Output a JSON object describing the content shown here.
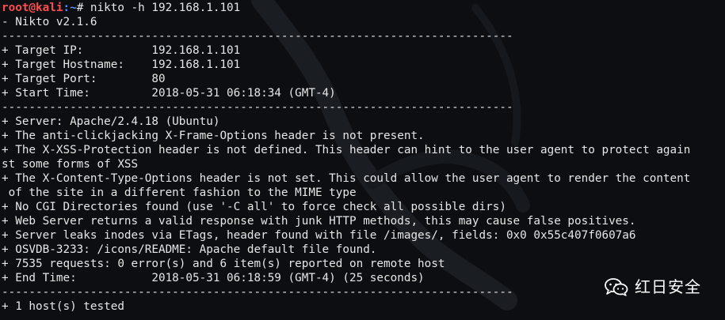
{
  "terminal": {
    "prompt": {
      "user_host": "root@kali",
      "path": ":~",
      "symbol": "#",
      "command": " nikto -h 192.168.1.101"
    },
    "lines": [
      "- Nikto v2.1.6",
      "---------------------------------------------------------------------------",
      "+ Target IP:          192.168.1.101",
      "+ Target Hostname:    192.168.1.101",
      "+ Target Port:        80",
      "+ Start Time:         2018-05-31 06:18:34 (GMT-4)",
      "---------------------------------------------------------------------------",
      "+ Server: Apache/2.4.18 (Ubuntu)",
      "+ The anti-clickjacking X-Frame-Options header is not present.",
      "+ The X-XSS-Protection header is not defined. This header can hint to the user agent to protect again",
      "st some forms of XSS",
      "+ The X-Content-Type-Options header is not set. This could allow the user agent to render the content",
      " of the site in a different fashion to the MIME type",
      "+ No CGI Directories found (use '-C all' to force check all possible dirs)",
      "+ Web Server returns a valid response with junk HTTP methods, this may cause false positives.",
      "+ Server leaks inodes via ETags, header found with file /images/, fields: 0x0 0x55c407f0607a6",
      "+ OSVDB-3233: /icons/README: Apache default file found.",
      "+ 7535 requests: 0 error(s) and 6 item(s) reported on remote host",
      "+ End Time:           2018-05-31 06:18:59 (GMT-4) (25 seconds)",
      "---------------------------------------------------------------------------",
      "+ 1 host(s) tested"
    ]
  },
  "watermark": {
    "icon": "wechat-icon",
    "text": "红日安全"
  },
  "colors": {
    "background": "#0c0e11",
    "text": "#e6e6e6",
    "prompt_user": "#ff4d4d",
    "prompt_path": "#5c8dff"
  }
}
